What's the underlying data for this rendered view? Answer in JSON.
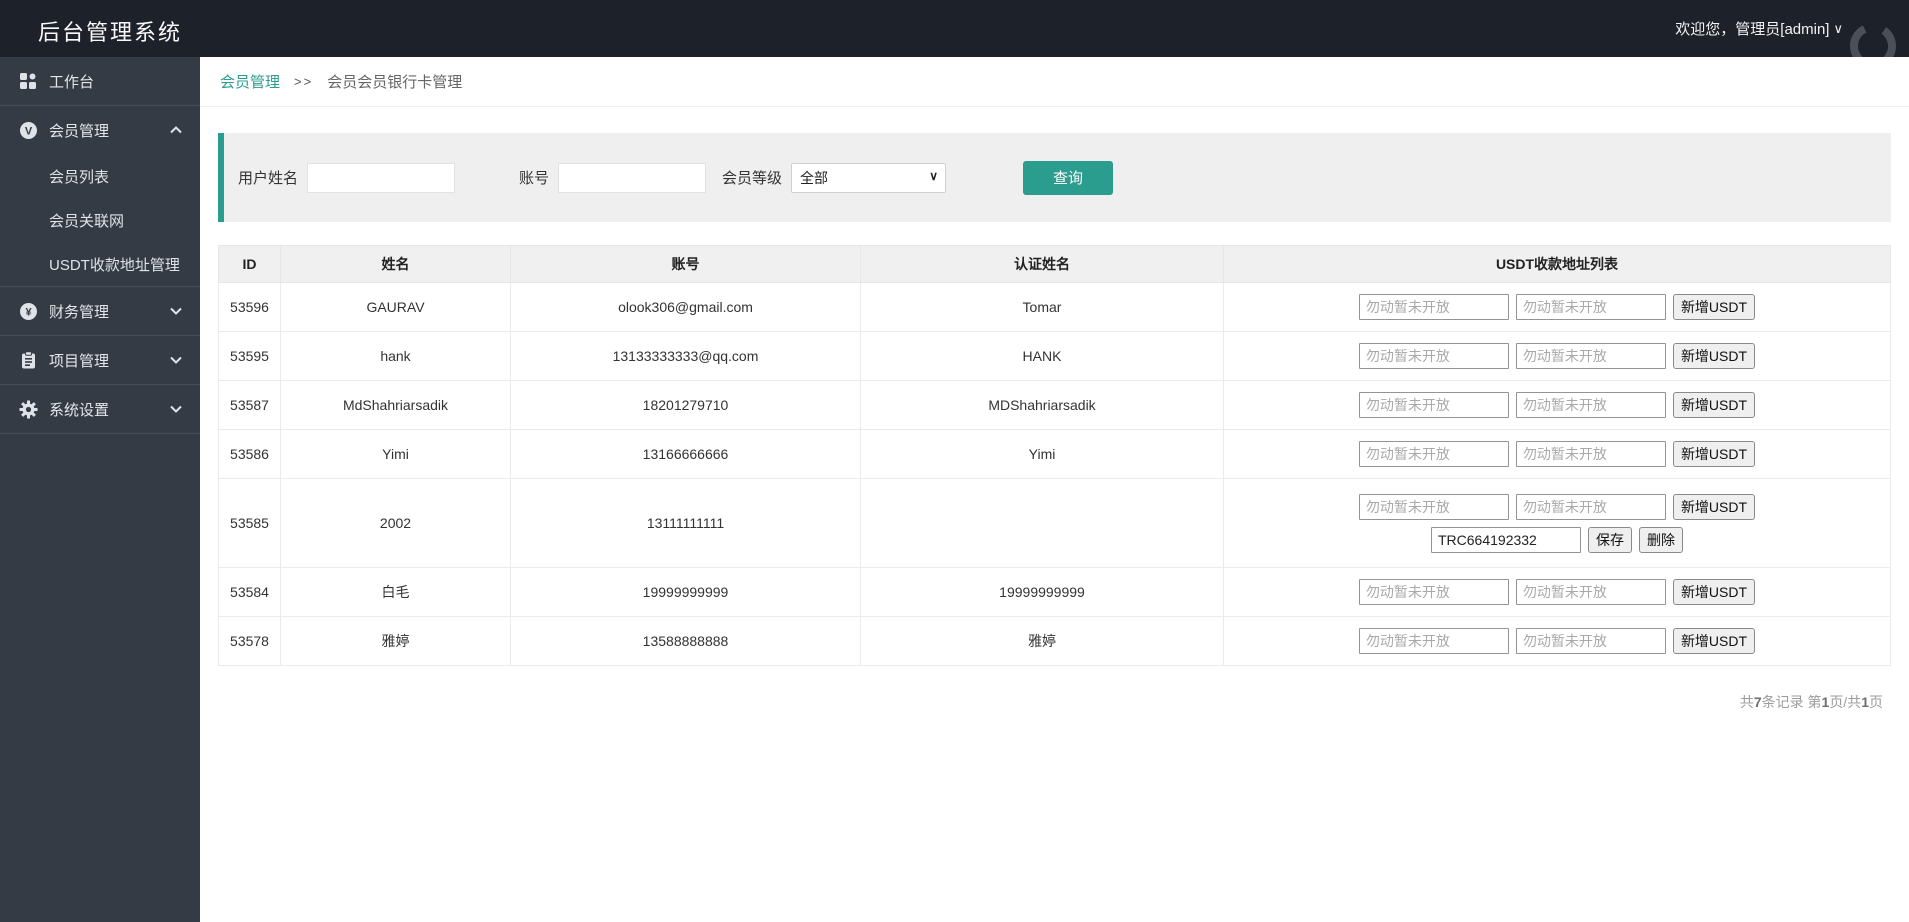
{
  "header": {
    "title": "后台管理系统",
    "welcome": "欢迎您，管理员[admin]",
    "caret": "∨"
  },
  "sidebar": {
    "workbench": "工作台",
    "member_mgmt": "会员管理",
    "member_children": {
      "list": "会员列表",
      "network": "会员关联网",
      "usdt": "USDT收款地址管理"
    },
    "finance": "财务管理",
    "project": "项目管理",
    "settings": "系统设置"
  },
  "breadcrumb": {
    "section": "会员管理",
    "separator": ">>",
    "current": "会员会员银行卡管理"
  },
  "filter": {
    "name_label": "用户姓名",
    "account_label": "账号",
    "level_label": "会员等级",
    "level_value": "全部",
    "search_button": "查询"
  },
  "table": {
    "columns": {
      "id": "ID",
      "name": "姓名",
      "account": "账号",
      "verified": "认证姓名",
      "usdt": "USDT收款地址列表"
    },
    "usdt_placeholder": "勿动暂未开放",
    "add_button": "新增USDT",
    "save_button": "保存",
    "delete_button": "删除",
    "rows": [
      {
        "id": "53596",
        "name": "GAURAV",
        "account": "olook306@gmail.com",
        "verified": "Tomar"
      },
      {
        "id": "53595",
        "name": "hank",
        "account": "13133333333@qq.com",
        "verified": "HANK"
      },
      {
        "id": "53587",
        "name": "MdShahriarsadik",
        "account": "18201279710",
        "verified": "MDShahriarsadik"
      },
      {
        "id": "53586",
        "name": "Yimi",
        "account": "13166666666",
        "verified": "Yimi"
      },
      {
        "id": "53585",
        "name": "2002",
        "account": "13111111111",
        "verified": "",
        "usdt_address": "TRC664192332"
      },
      {
        "id": "53584",
        "name": "白毛",
        "account": "19999999999",
        "verified": "19999999999"
      },
      {
        "id": "53578",
        "name": "雅婷",
        "account": "13588888888",
        "verified": "雅婷"
      }
    ]
  },
  "pagination": {
    "t1": "共",
    "count": "7",
    "t2": "条记录 ",
    "t3": "第",
    "page": "1",
    "t4": "页/共",
    "total": "1",
    "t5": "页"
  },
  "colors": {
    "accent": "#2a9d8f",
    "topbar": "#1d212a",
    "sidebar": "#353b45"
  }
}
